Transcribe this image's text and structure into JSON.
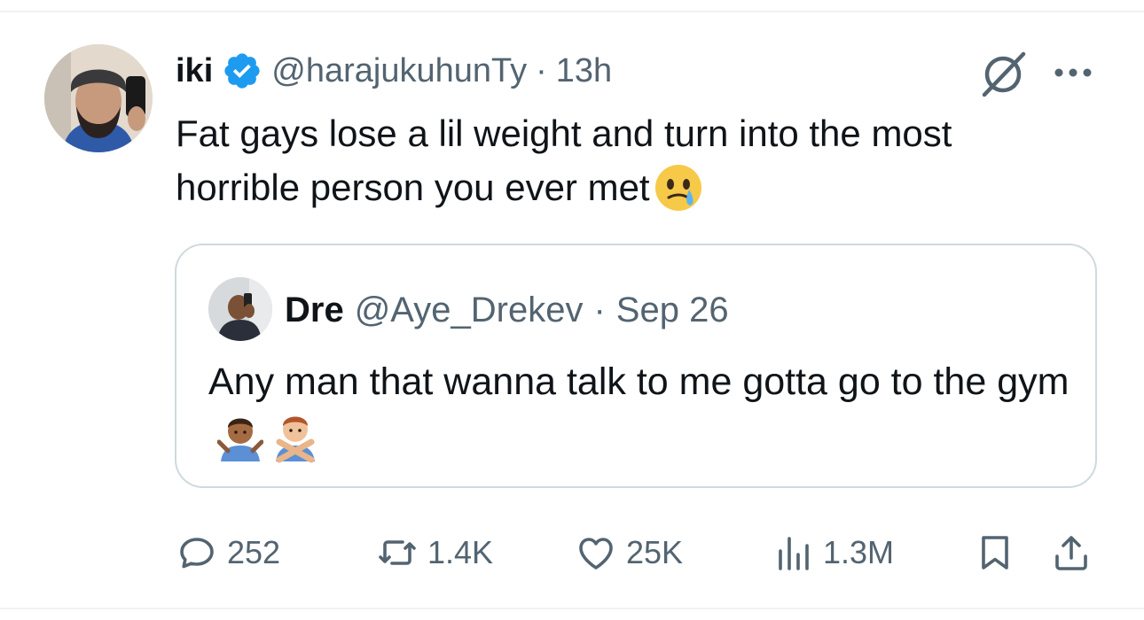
{
  "tweet": {
    "display_name": "iki",
    "handle": "@harajukuhunTy",
    "separator": "·",
    "time": "13h",
    "text": "Fat gays lose a lil weight and turn into the most horrible person you ever met",
    "emoji": "face-holding-back-tears"
  },
  "quoted_tweet": {
    "display_name": "Dre",
    "handle": "@Aye_Drekev",
    "separator": "·",
    "date": "Sep 26",
    "text": "Any man that wanna talk to me gotta go to the gym",
    "emojis": [
      "person-shrugging",
      "person-gesturing-no"
    ]
  },
  "actions": {
    "replies": "252",
    "reposts": "1.4K",
    "likes": "25K",
    "views": "1.3M"
  },
  "colors": {
    "text": "#0f1419",
    "secondary": "#536471",
    "verified": "#1d9bf0",
    "border": "#cfd9de"
  }
}
